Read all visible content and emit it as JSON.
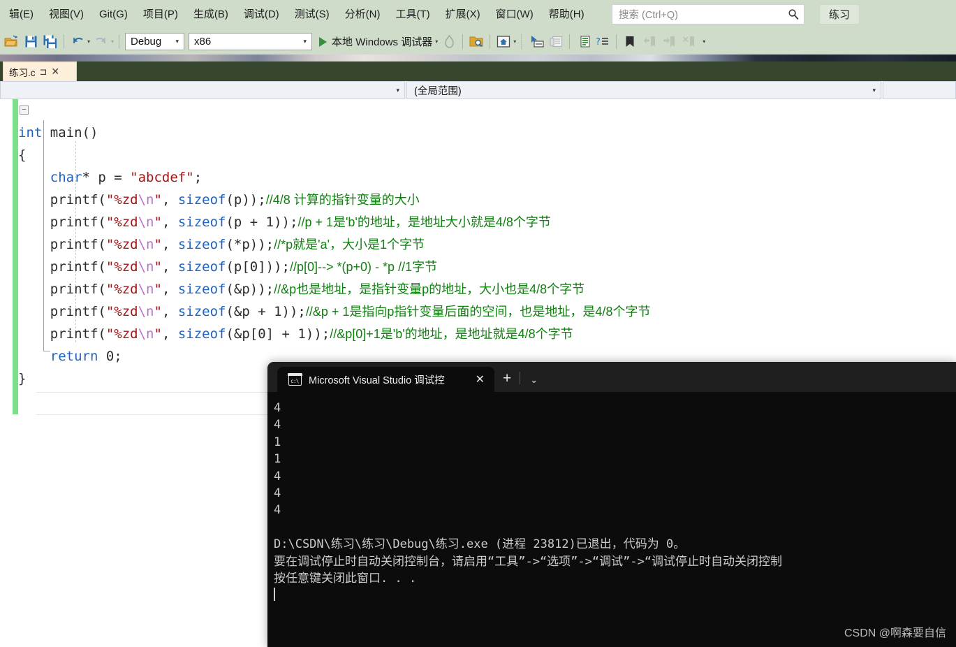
{
  "menu": {
    "items": [
      {
        "label": "辑(E)"
      },
      {
        "label": "视图(V)"
      },
      {
        "label": "Git(G)"
      },
      {
        "label": "项目(P)"
      },
      {
        "label": "生成(B)"
      },
      {
        "label": "调试(D)"
      },
      {
        "label": "测试(S)"
      },
      {
        "label": "分析(N)"
      },
      {
        "label": "工具(T)"
      },
      {
        "label": "扩展(X)"
      },
      {
        "label": "窗口(W)"
      },
      {
        "label": "帮助(H)"
      }
    ],
    "search_placeholder": "搜索 (Ctrl+Q)",
    "search_value": "",
    "project_button": "练习"
  },
  "toolbar": {
    "config": "Debug",
    "platform": "x86",
    "run_label": "本地 Windows 调试器"
  },
  "tabs": {
    "document": "练习.c",
    "pin_glyph": "⊐",
    "close_glyph": "✕"
  },
  "navbar": {
    "project_scope": "",
    "scope": "(全局范围)",
    "member": ""
  },
  "code": {
    "lines": [
      {
        "kind": "plain",
        "segments": [
          {
            "t": "int",
            "c": "kw"
          },
          {
            "t": " main",
            "c": "fn"
          },
          {
            "t": "()",
            "c": "pun"
          }
        ]
      },
      {
        "kind": "plain",
        "segments": [
          {
            "t": "{",
            "c": "pun"
          }
        ]
      },
      {
        "kind": "plain",
        "segments": [
          {
            "t": "    ",
            "c": "pun"
          },
          {
            "t": "char",
            "c": "kw"
          },
          {
            "t": "* p = ",
            "c": "pun"
          },
          {
            "t": "\"abcdef\"",
            "c": "str"
          },
          {
            "t": ";",
            "c": "pun"
          }
        ]
      },
      {
        "kind": "plain",
        "segments": [
          {
            "t": "    printf(",
            "c": "pun"
          },
          {
            "t": "\"%zd",
            "c": "str"
          },
          {
            "t": "\\n",
            "c": "esc"
          },
          {
            "t": "\"",
            "c": "str"
          },
          {
            "t": ", ",
            "c": "pun"
          },
          {
            "t": "sizeof",
            "c": "szo"
          },
          {
            "t": "(p));",
            "c": "pun"
          },
          {
            "t": "//4/8 计算的指针变量的大小",
            "c": "cmt"
          }
        ]
      },
      {
        "kind": "plain",
        "segments": [
          {
            "t": "    printf(",
            "c": "pun"
          },
          {
            "t": "\"%zd",
            "c": "str"
          },
          {
            "t": "\\n",
            "c": "esc"
          },
          {
            "t": "\"",
            "c": "str"
          },
          {
            "t": ", ",
            "c": "pun"
          },
          {
            "t": "sizeof",
            "c": "szo"
          },
          {
            "t": "(p + 1));",
            "c": "pun"
          },
          {
            "t": "//p + 1是'b'的地址，是地址大小就是4/8个字节",
            "c": "cmt"
          }
        ]
      },
      {
        "kind": "plain",
        "segments": [
          {
            "t": "    printf(",
            "c": "pun"
          },
          {
            "t": "\"%zd",
            "c": "str"
          },
          {
            "t": "\\n",
            "c": "esc"
          },
          {
            "t": "\"",
            "c": "str"
          },
          {
            "t": ", ",
            "c": "pun"
          },
          {
            "t": "sizeof",
            "c": "szo"
          },
          {
            "t": "(*p));",
            "c": "pun"
          },
          {
            "t": "//*p就是'a'，大小是1个字节",
            "c": "cmt"
          }
        ]
      },
      {
        "kind": "plain",
        "segments": [
          {
            "t": "    printf(",
            "c": "pun"
          },
          {
            "t": "\"%zd",
            "c": "str"
          },
          {
            "t": "\\n",
            "c": "esc"
          },
          {
            "t": "\"",
            "c": "str"
          },
          {
            "t": ", ",
            "c": "pun"
          },
          {
            "t": "sizeof",
            "c": "szo"
          },
          {
            "t": "(p[0]));",
            "c": "pun"
          },
          {
            "t": "//p[0]--> *(p+0) - *p //1字节",
            "c": "cmt"
          }
        ]
      },
      {
        "kind": "plain",
        "segments": [
          {
            "t": "    printf(",
            "c": "pun"
          },
          {
            "t": "\"%zd",
            "c": "str"
          },
          {
            "t": "\\n",
            "c": "esc"
          },
          {
            "t": "\"",
            "c": "str"
          },
          {
            "t": ", ",
            "c": "pun"
          },
          {
            "t": "sizeof",
            "c": "szo"
          },
          {
            "t": "(&p));",
            "c": "pun"
          },
          {
            "t": "//&p也是地址，是指针变量p的地址，大小也是4/8个字节",
            "c": "cmt"
          }
        ]
      },
      {
        "kind": "plain",
        "segments": [
          {
            "t": "    printf(",
            "c": "pun"
          },
          {
            "t": "\"%zd",
            "c": "str"
          },
          {
            "t": "\\n",
            "c": "esc"
          },
          {
            "t": "\"",
            "c": "str"
          },
          {
            "t": ", ",
            "c": "pun"
          },
          {
            "t": "sizeof",
            "c": "szo"
          },
          {
            "t": "(&p + 1));",
            "c": "pun"
          },
          {
            "t": "//&p + 1是指向p指针变量后面的空间，也是地址，是4/8个字节",
            "c": "cmt"
          }
        ]
      },
      {
        "kind": "plain",
        "segments": [
          {
            "t": "    printf(",
            "c": "pun"
          },
          {
            "t": "\"%zd",
            "c": "str"
          },
          {
            "t": "\\n",
            "c": "esc"
          },
          {
            "t": "\"",
            "c": "str"
          },
          {
            "t": ", ",
            "c": "pun"
          },
          {
            "t": "sizeof",
            "c": "szo"
          },
          {
            "t": "(&p[0] + 1));",
            "c": "pun"
          },
          {
            "t": "//&p[0]+1是'b'的地址，是地址就是4/8个字节",
            "c": "cmt"
          }
        ]
      },
      {
        "kind": "plain",
        "segments": [
          {
            "t": "    ",
            "c": "pun"
          },
          {
            "t": "return",
            "c": "kw"
          },
          {
            "t": " 0;",
            "c": "pun"
          }
        ]
      },
      {
        "kind": "plain",
        "segments": [
          {
            "t": "}",
            "c": "pun"
          }
        ]
      }
    ]
  },
  "console": {
    "tab_title": "Microsoft Visual Studio 调试控",
    "close_glyph": "✕",
    "new_tab_glyph": "+",
    "chevron_glyph": "⌄",
    "output_lines": [
      "4",
      "4",
      "1",
      "1",
      "4",
      "4",
      "4",
      "",
      "D:\\CSDN\\练习\\练习\\Debug\\练习.exe (进程 23812)已退出，代码为 0。",
      "要在调试停止时自动关闭控制台，请启用“工具”->“选项”->“调试”->“调试停止时自动关闭控制",
      "按任意键关闭此窗口. . ."
    ],
    "watermark": "CSDN @啊森要自信"
  },
  "colors": {
    "menu_bg": "#cfdcc9",
    "keyword": "#1f61c4",
    "string": "#a31515",
    "comment": "#108010",
    "escape": "#c06fd0",
    "changebar": "#7ce08a",
    "console_bg": "#0c0c0c"
  }
}
